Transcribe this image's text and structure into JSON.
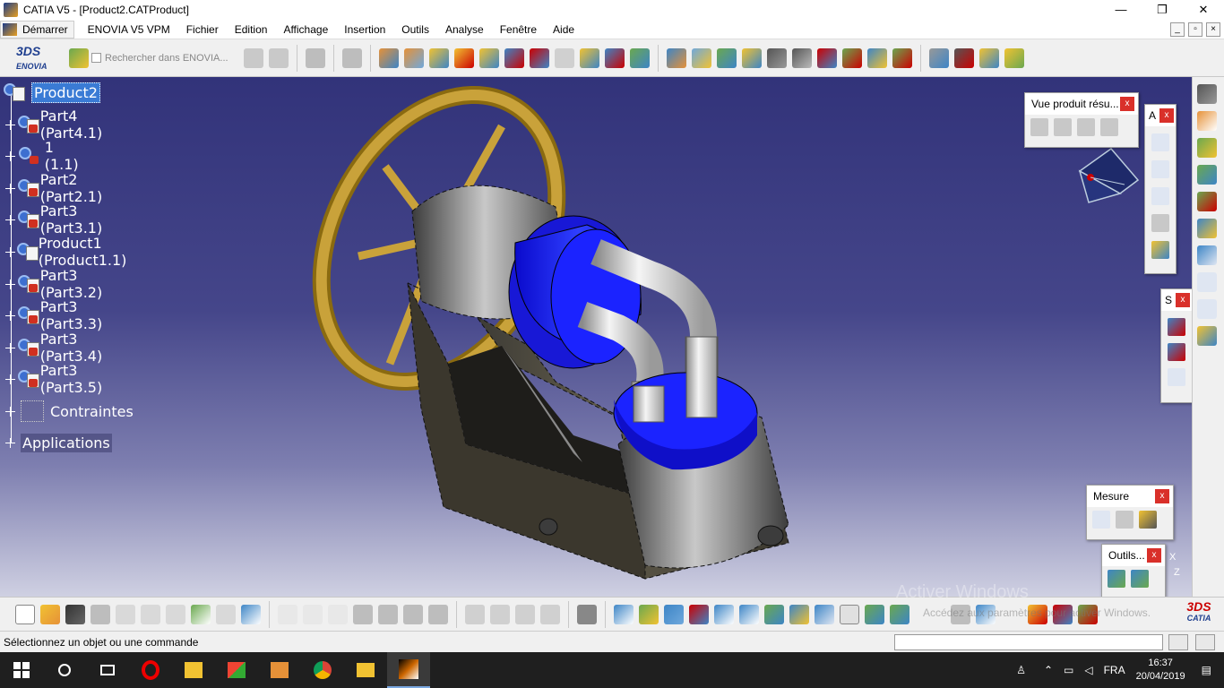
{
  "window": {
    "title": "CATIA V5 - [Product2.CATProduct]",
    "controls": [
      "—",
      "❐",
      "✕"
    ]
  },
  "menubar": {
    "start_label": "Démarrer",
    "items": [
      "ENOVIA V5 VPM",
      "Fichier",
      "Edition",
      "Affichage",
      "Insertion",
      "Outils",
      "Analyse",
      "Fenêtre",
      "Aide"
    ]
  },
  "toolbar_top": {
    "logo_ds": "3DS",
    "logo_text": "ENOVIA",
    "search_label": "Rechercher dans ENOVIA..."
  },
  "spec_tree": {
    "root": "Product2",
    "items": [
      {
        "label": "Part4 (Part4.1)",
        "kind": "part"
      },
      {
        "label": "1 (1.1)",
        "kind": "part"
      },
      {
        "label": "Part2 (Part2.1)",
        "kind": "part"
      },
      {
        "label": "Part3 (Part3.1)",
        "kind": "part"
      },
      {
        "label": "Product1 (Product1.1)",
        "kind": "product"
      },
      {
        "label": "Part3 (Part3.2)",
        "kind": "part"
      },
      {
        "label": "Part3 (Part3.3)",
        "kind": "part"
      },
      {
        "label": "Part3 (Part3.4)",
        "kind": "part"
      },
      {
        "label": "Part3 (Part3.5)",
        "kind": "part"
      },
      {
        "label": "Contraintes",
        "kind": "constraints"
      },
      {
        "label": "Applications",
        "kind": "applications"
      }
    ]
  },
  "panels": {
    "vue_produit": {
      "title": "Vue produit résu...",
      "close": "x"
    },
    "a_panel": {
      "title": "A",
      "close": "x"
    },
    "s_panel": {
      "title": "S",
      "close": "x"
    },
    "mesure": {
      "title": "Mesure",
      "close": "x"
    },
    "outils": {
      "title": "Outils...",
      "close": "x"
    }
  },
  "compass": {
    "axis_x": "X",
    "axis_z": "Z"
  },
  "watermark": {
    "line1": "Activer Windows",
    "line2": "Accédez aux paramètres pour activer Windows."
  },
  "bottom_logo": "CATIA",
  "status": {
    "message": "Sélectionnez un objet ou une commande"
  },
  "taskbar": {
    "lang": "FRA",
    "time": "16:37",
    "date": "20/04/2019"
  },
  "colors": {
    "viewport_top": "#32337a",
    "viewport_bottom": "#cfd0e2",
    "selection": "#3a7bd5",
    "close_button": "#d9302a"
  }
}
